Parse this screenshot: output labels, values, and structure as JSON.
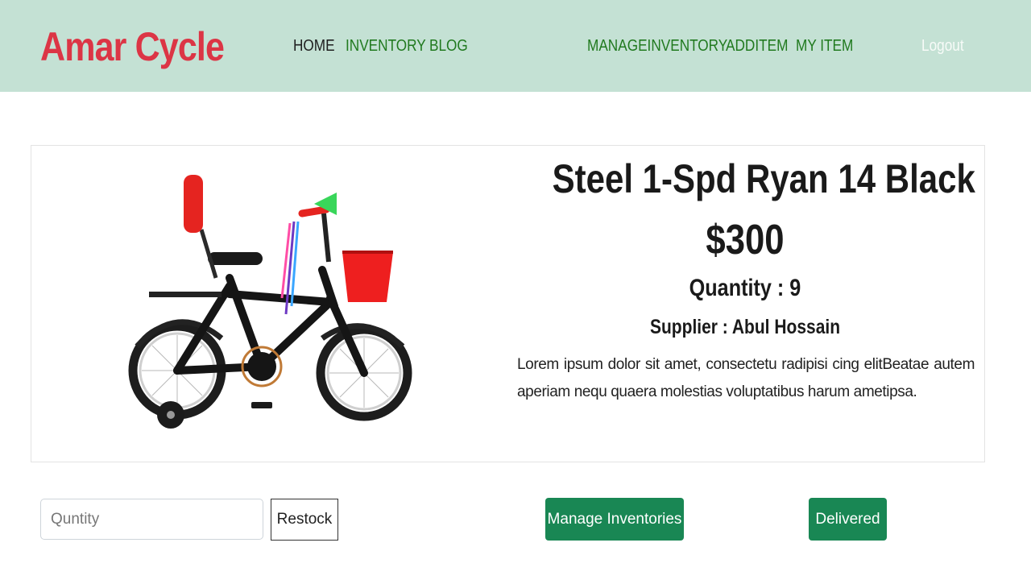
{
  "brand": "Amar Cycle",
  "nav": {
    "home": "HOME",
    "inventory": "INVENTORY",
    "blog": "BLOG",
    "manage_inventory": "MANAGEINVENTORY",
    "add_item": "ADDITEM",
    "my_item": "MY ITEM",
    "logout": "Logout"
  },
  "product": {
    "name": "Steel 1-Spd Ryan 14 Black",
    "price": "$300",
    "quantity": "Quantity : 9",
    "supplier": "Supplier : Abul Hossain",
    "description": "Lorem ipsum dolor sit amet, consectetu radipisi cing elitBeatae autem aperiam nequ quaera molestias voluptatibus harum ametipsa.",
    "image_icon": "bicycle-image"
  },
  "actions": {
    "quantity_placeholder": "Quntity",
    "restock": "Restock",
    "manage_inventories": "Manage Inventories",
    "delivered": "Delivered"
  },
  "colors": {
    "navbar_bg": "#c4e1d4",
    "brand": "#dc3545",
    "nav_link": "#217a1f",
    "button_green": "#198754"
  }
}
